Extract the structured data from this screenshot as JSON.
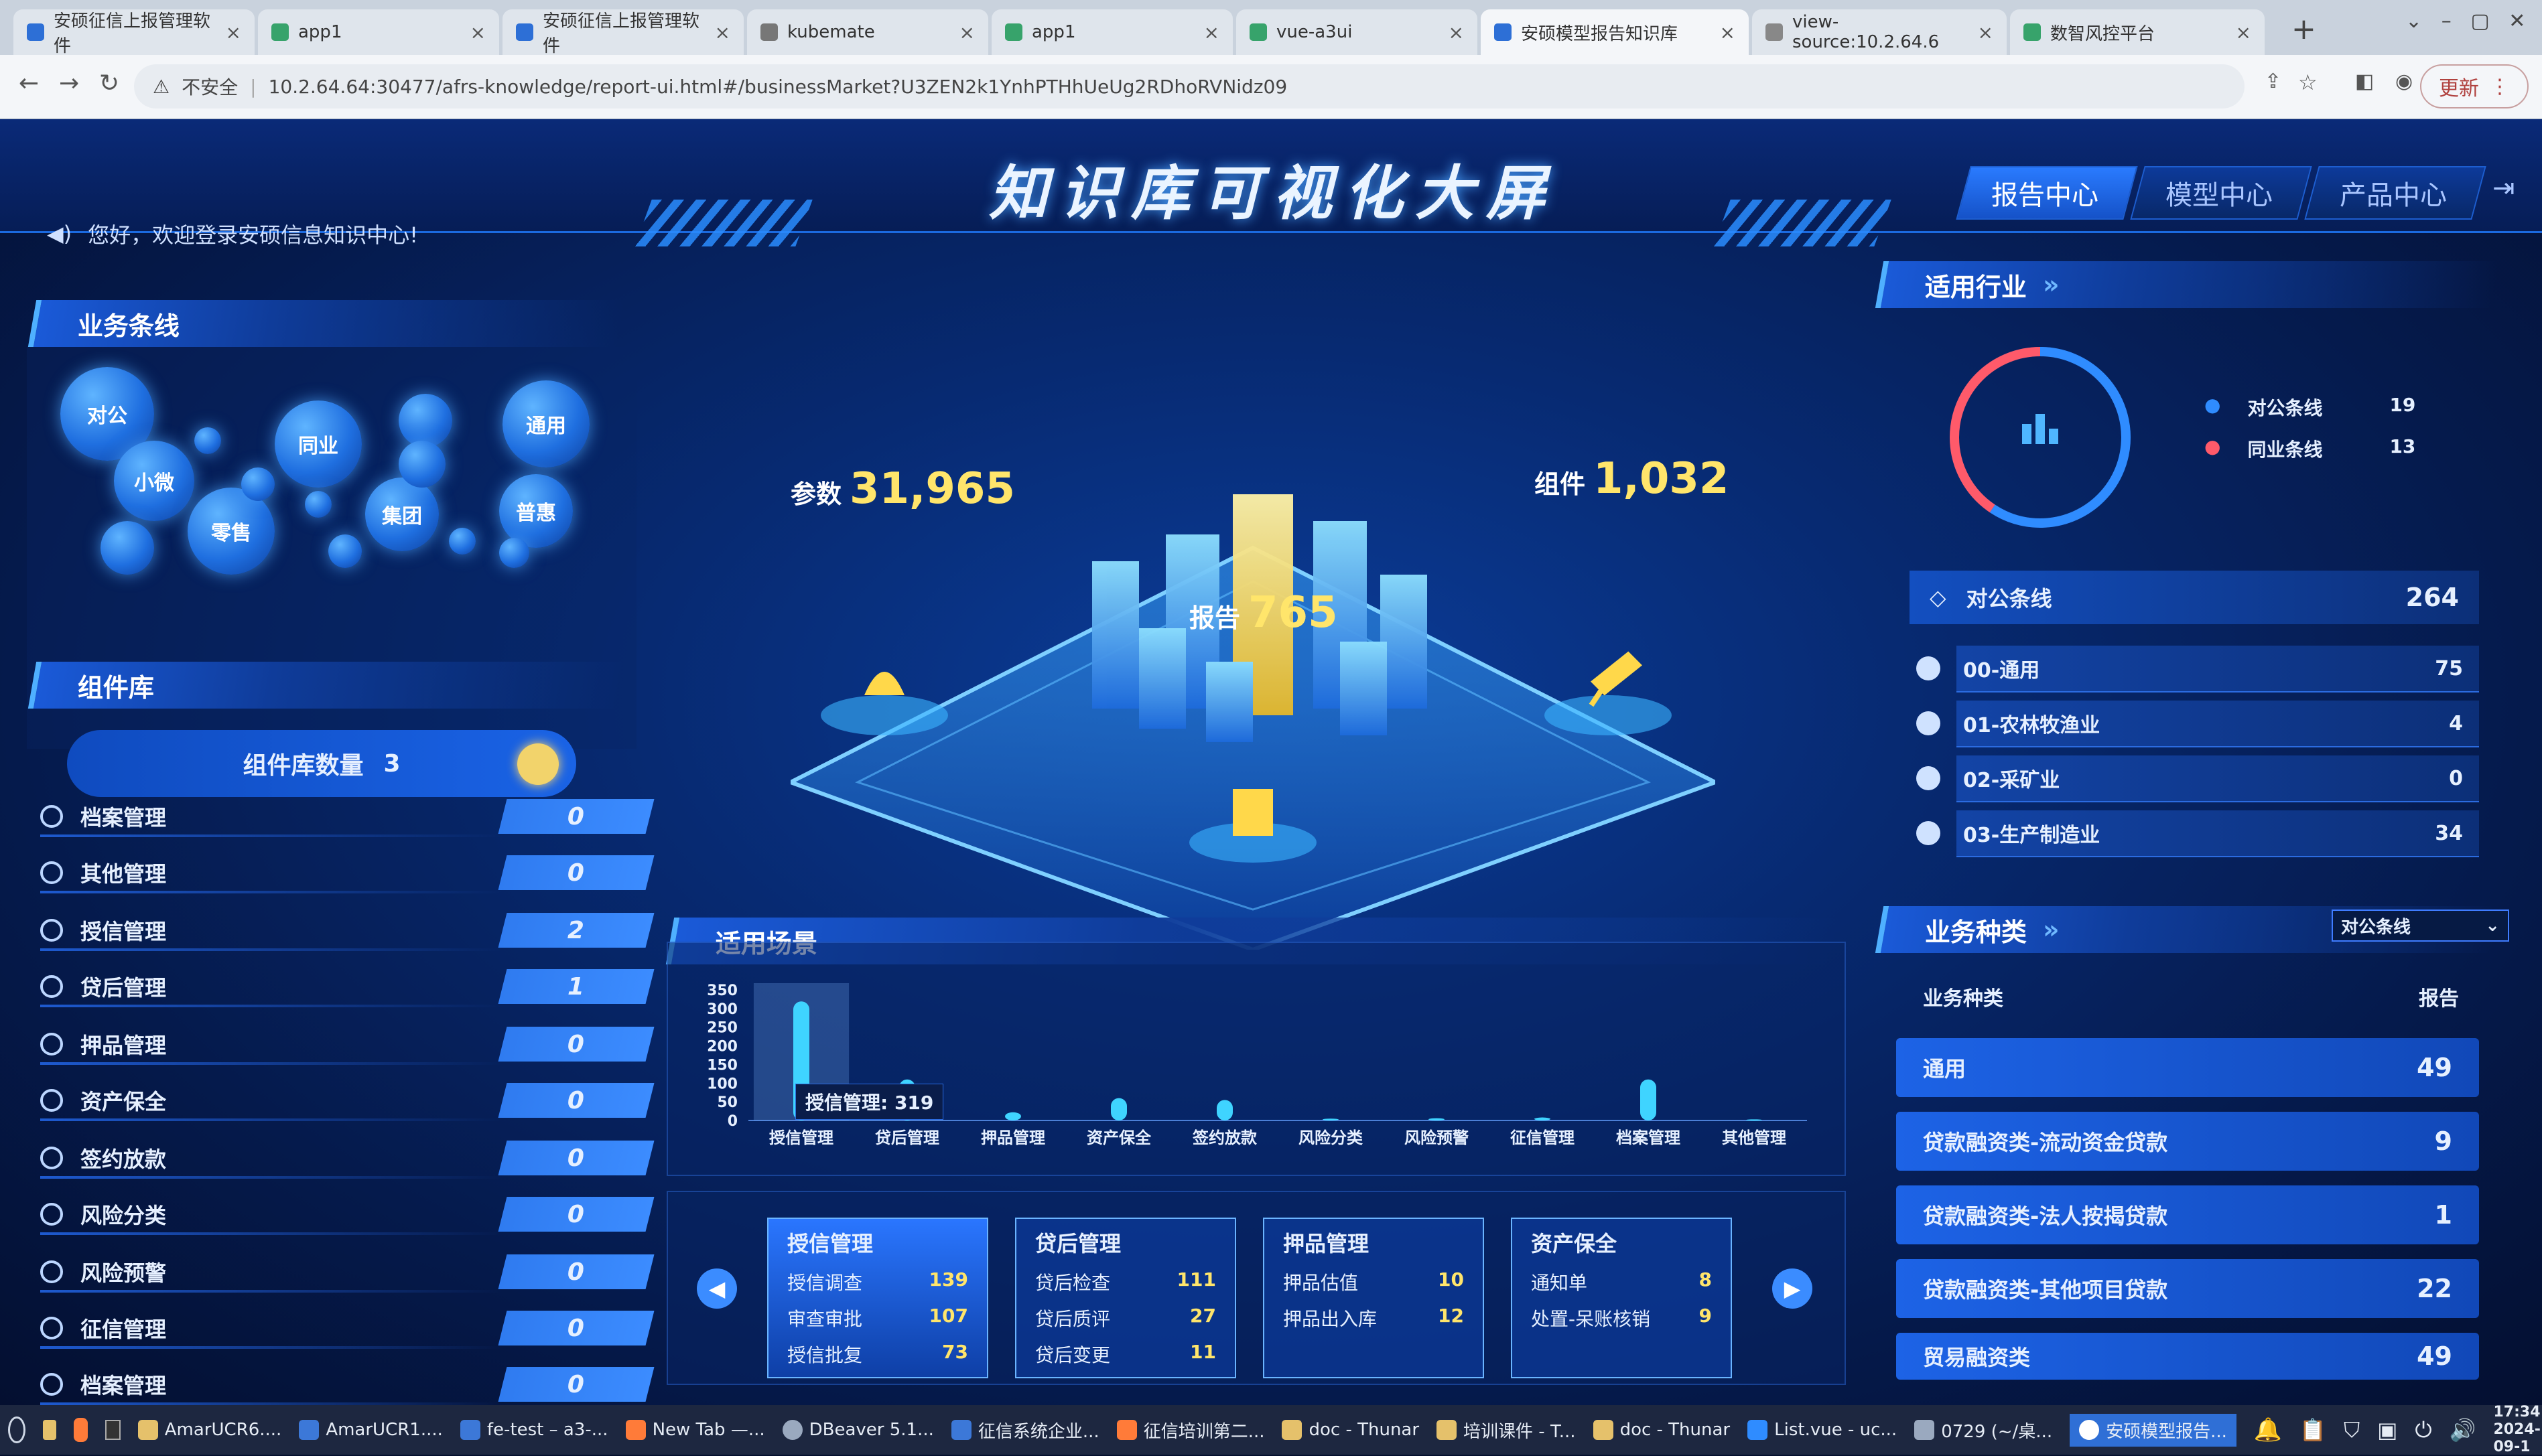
{
  "browser": {
    "tabs": [
      {
        "label": "安硕征信上报管理软件",
        "icon_color": "#2d6fd6"
      },
      {
        "label": "app1",
        "icon_color": "#37a36b"
      },
      {
        "label": "安硕征信上报管理软件",
        "icon_color": "#2d6fd6"
      },
      {
        "label": "kubemate",
        "icon_color": "#777777"
      },
      {
        "label": "app1",
        "icon_color": "#37a36b"
      },
      {
        "label": "vue-a3ui",
        "icon_color": "#37a36b"
      },
      {
        "label": "安硕模型报告知识库",
        "icon_color": "#2d6fd6"
      },
      {
        "label": "view-source:10.2.64.6",
        "icon_color": "#888888"
      },
      {
        "label": "数智风控平台",
        "icon_color": "#37a36b"
      }
    ],
    "security_label": "不安全",
    "url": "10.2.64.64:30477/afrs-knowledge/report-ui.html#/businessMarket?U3ZEN2k1YnhPTHhUeUg2RDhoRVNidz09",
    "update_label": "更新"
  },
  "header": {
    "title": "知识库可视化大屏",
    "welcome": "您好，欢迎登录安硕信息知识中心!",
    "nav": [
      "报告中心",
      "模型中心",
      "产品中心"
    ],
    "active_nav": "报告中心"
  },
  "business_line": {
    "title": "业务条线",
    "bubbles": [
      "对公",
      "小微",
      "同业",
      "零售",
      "集团",
      "通用",
      "普惠"
    ]
  },
  "component_lib": {
    "title": "组件库",
    "count_label": "组件库数量",
    "count": "3",
    "rows": [
      {
        "name": "档案管理",
        "value": "0"
      },
      {
        "name": "其他管理",
        "value": "0"
      },
      {
        "name": "授信管理",
        "value": "2"
      },
      {
        "name": "贷后管理",
        "value": "1"
      },
      {
        "name": "押品管理",
        "value": "0"
      },
      {
        "name": "资产保全",
        "value": "0"
      },
      {
        "name": "签约放款",
        "value": "0"
      },
      {
        "name": "风险分类",
        "value": "0"
      },
      {
        "name": "风险预警",
        "value": "0"
      },
      {
        "name": "征信管理",
        "value": "0"
      },
      {
        "name": "档案管理",
        "value": "0"
      }
    ]
  },
  "center_stats": {
    "params_label": "参数",
    "params_value": "31,965",
    "components_label": "组件",
    "components_value": "1,032",
    "reports_label": "报告",
    "reports_value": "765"
  },
  "scenes": {
    "title": "适用场景",
    "tooltip": "授信管理: 319",
    "cards": [
      {
        "title": "授信管理",
        "rows": [
          {
            "k": "授信调查",
            "v": "139"
          },
          {
            "k": "审查审批",
            "v": "107"
          },
          {
            "k": "授信批复",
            "v": "73"
          }
        ]
      },
      {
        "title": "贷后管理",
        "rows": [
          {
            "k": "贷后检查",
            "v": "111"
          },
          {
            "k": "贷后质评",
            "v": "27"
          },
          {
            "k": "贷后变更",
            "v": "11"
          }
        ]
      },
      {
        "title": "押品管理",
        "rows": [
          {
            "k": "押品估值",
            "v": "10"
          },
          {
            "k": "押品出入库",
            "v": "12"
          }
        ]
      },
      {
        "title": "资产保全",
        "rows": [
          {
            "k": "通知单",
            "v": "8"
          },
          {
            "k": "处置-呆账核销",
            "v": "9"
          }
        ]
      }
    ]
  },
  "chart_data": {
    "type": "bar",
    "categories": [
      "授信管理",
      "贷后管理",
      "押品管理",
      "资产保全",
      "签约放款",
      "风险分类",
      "风险预警",
      "征信管理",
      "档案管理",
      "其他管理"
    ],
    "values": [
      319,
      110,
      22,
      60,
      55,
      5,
      6,
      8,
      110,
      3
    ],
    "yticks": [
      0,
      50,
      100,
      150,
      200,
      250,
      300,
      350
    ],
    "ylim": [
      0,
      350
    ],
    "color": "#3fd4ff"
  },
  "industry": {
    "title": "适用行业",
    "legend": [
      {
        "label": "对公条线",
        "value": "19",
        "color": "#2f8cff"
      },
      {
        "label": "同业条线",
        "value": "13",
        "color": "#ff5a6a"
      }
    ],
    "group_label": "对公条线",
    "group_value": "264",
    "rows": [
      {
        "name": "00-通用",
        "value": "75"
      },
      {
        "name": "01-农林牧渔业",
        "value": "4"
      },
      {
        "name": "02-采矿业",
        "value": "0"
      },
      {
        "name": "03-生产制造业",
        "value": "34"
      }
    ]
  },
  "business_type": {
    "title": "业务种类",
    "select": "对公条线",
    "col1": "业务种类",
    "col2": "报告",
    "rows": [
      {
        "name": "通用",
        "value": "49"
      },
      {
        "name": "贷款融资类-流动资金贷款",
        "value": "9"
      },
      {
        "name": "贷款融资类-法人按揭贷款",
        "value": "1"
      },
      {
        "name": "贷款融资类-其他项目贷款",
        "value": "22"
      },
      {
        "name": "贸易融资类",
        "value": "49"
      }
    ]
  },
  "taskbar": {
    "items": [
      "AmarUCR6....",
      "AmarUCR1....",
      "fe-test – a3-...",
      "New Tab —...",
      "DBeaver 5.1...",
      "征信系统企业...",
      "征信培训第二...",
      "doc - Thunar",
      "培训课件 - T...",
      "doc - Thunar",
      "List.vue - uc...",
      "0729 (~/桌...",
      "安硕模型报告..."
    ],
    "time": "17:34",
    "date": "2024-09-1"
  }
}
